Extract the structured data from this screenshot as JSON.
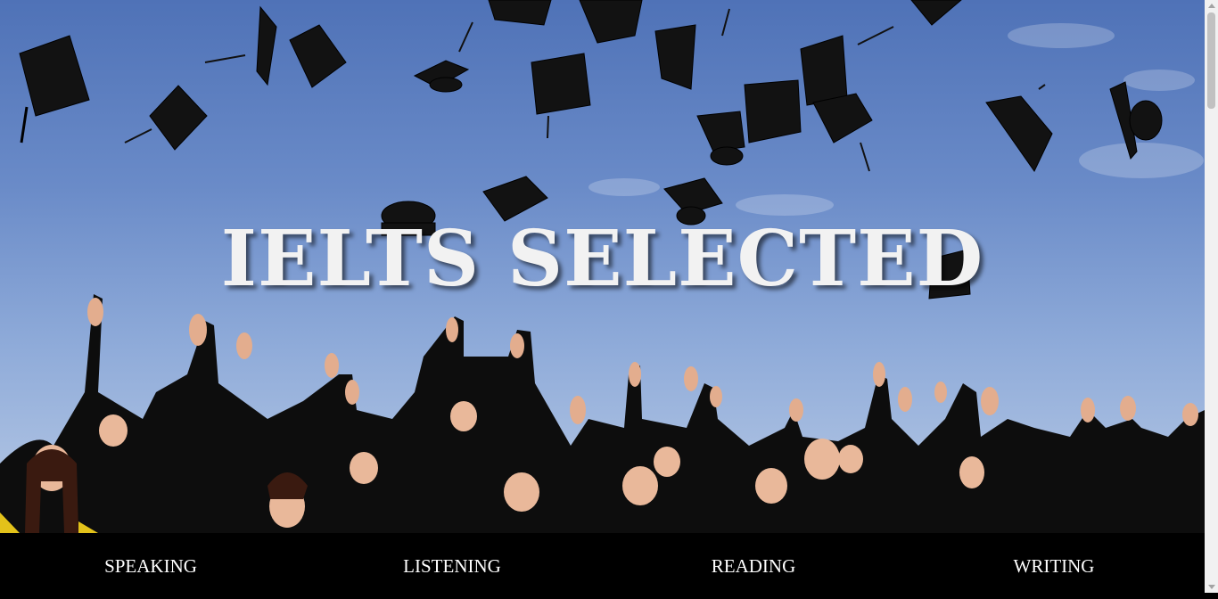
{
  "hero": {
    "title": "IELTS SELECTED",
    "background_image": "graduation-caps-thrown-in-sky",
    "sky_color": "#5f80c0"
  },
  "nav": {
    "items": [
      {
        "label": "SPEAKING"
      },
      {
        "label": "LISTENING"
      },
      {
        "label": "READING"
      },
      {
        "label": "WRITING"
      }
    ]
  },
  "colors": {
    "nav_background": "#000000",
    "nav_text": "#ffffff",
    "title_text": "#f2f2f2"
  }
}
